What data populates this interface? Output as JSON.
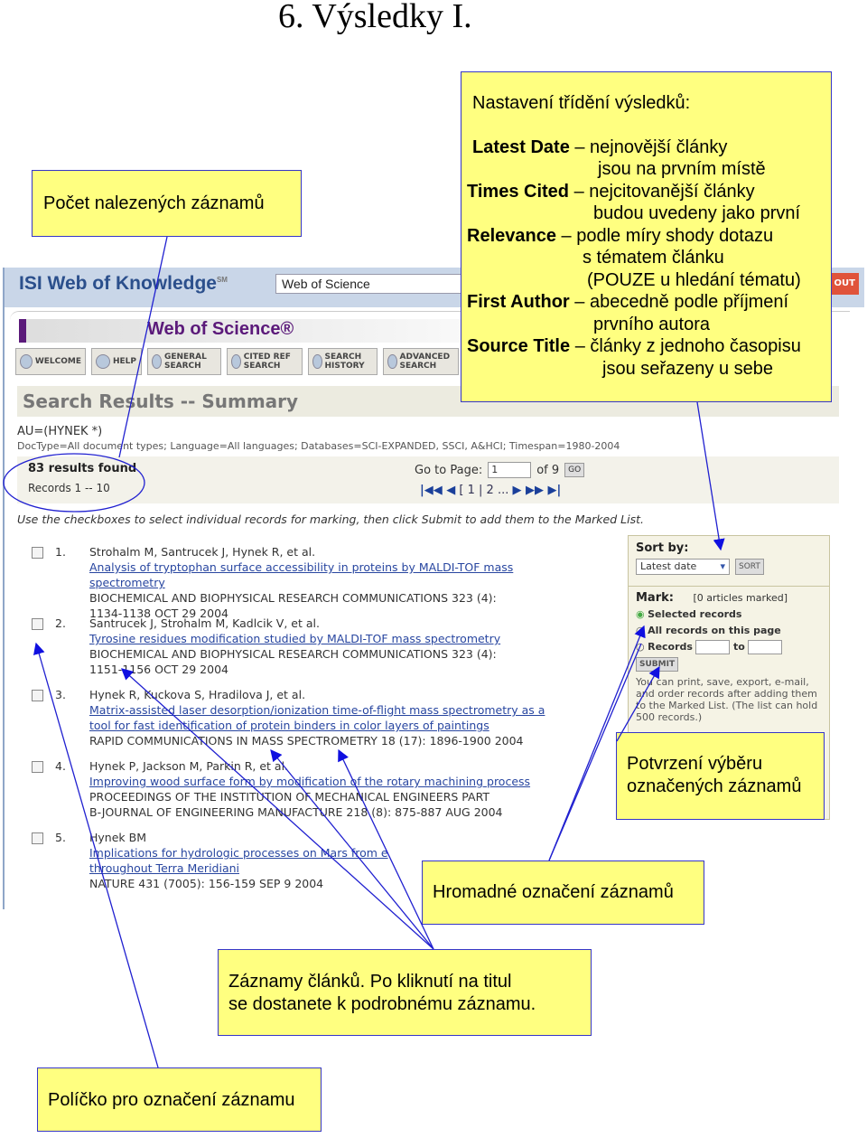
{
  "title": "6.  Výsledky I.",
  "screenshot": {
    "brand": "ISI Web of Knowledge",
    "brand_sup": "SM",
    "database_select": "Web of Science",
    "logout": "OUT",
    "wos_logo": "Web of Science®",
    "nav": [
      {
        "label": "WELCOME",
        "icon": "home-icon"
      },
      {
        "label": "HELP",
        "icon": "help-icon"
      },
      {
        "label": "GENERAL SEARCH",
        "icon": "search-icon"
      },
      {
        "label": "CITED REF SEARCH",
        "icon": "search-icon"
      },
      {
        "label": "SEARCH HISTORY",
        "icon": "history-icon"
      },
      {
        "label": "ADVANCED SEARCH",
        "icon": "advanced-search-icon"
      }
    ],
    "section_title": "Search Results -- Summary",
    "query": "AU=(HYNEK *)",
    "doctype": "DocType=All document types; Language=All languages; Databases=SCI-EXPANDED, SSCI, A&HCI; Timespan=1980-2004",
    "results_found": "83 results found",
    "records_range": "Records 1 -- 10",
    "goto_label": "Go to Page:",
    "goto_value": "1",
    "of_pages": "of 9",
    "go": "GO",
    "pager": "[ 1 | 2 ...",
    "instructions": "Use the checkboxes to select individual records for marking, then click Submit to add them to the Marked List.",
    "records": [
      {
        "num": "1.",
        "authors": "Strohalm M, Santrucek J, Hynek R, et al.",
        "title1": "Analysis of tryptophan surface accessibility in proteins by MALDI-TOF mass",
        "title2": "spectrometry",
        "source1": "BIOCHEMICAL AND BIOPHYSICAL RESEARCH COMMUNICATIONS 323 (4):",
        "source2": "1134-1138 OCT 29 2004"
      },
      {
        "num": "2.",
        "authors": "Santrucek J, Strohalm M, Kadlcik V, et al.",
        "title1": "Tyrosine residues modification studied by MALDI-TOF mass spectrometry",
        "title2": "",
        "source1": "BIOCHEMICAL AND BIOPHYSICAL RESEARCH COMMUNICATIONS 323 (4):",
        "source2": "1151-1156 OCT 29 2004"
      },
      {
        "num": "3.",
        "authors": "Hynek R, Kuckova S, Hradilova J, et al.",
        "title1": "Matrix-assisted laser desorption/ionization time-of-flight mass spectrometry as a",
        "title2": "tool for fast identification of protein binders in color layers of paintings",
        "source1": "RAPID COMMUNICATIONS IN MASS SPECTROMETRY 18 (17): 1896-1900 2004",
        "source2": ""
      },
      {
        "num": "4.",
        "authors": "Hynek P, Jackson M, Parkin R, et al.",
        "title1": "Improving wood surface form by modification of the rotary machining process",
        "title2": "",
        "source1": "PROCEEDINGS OF THE INSTITUTION OF MECHANICAL ENGINEERS PART",
        "source2": "B-JOURNAL OF ENGINEERING MANUFACTURE 218 (8): 875-887 AUG 2004"
      },
      {
        "num": "5.",
        "authors": "Hynek BM",
        "title1": "Implications for hydrologic processes on Mars from e",
        "title2": "throughout Terra Meridiani",
        "source1": "NATURE 431 (7005): 156-159 SEP 9 2004",
        "source2": ""
      }
    ],
    "sidebar": {
      "sort_by": "Sort by:",
      "sort_value": "Latest date",
      "sort_button": "SORT",
      "mark": "Mark:",
      "marked_count": "[0 articles marked]",
      "opt_selected": "Selected records",
      "opt_all": "All records on this page",
      "opt_range": "Records",
      "to": "to",
      "submit": "SUBMIT",
      "note": "You can print, save, export, e-mail, and order records after adding them to the Marked List. (The list can hold 500 records.)"
    }
  },
  "annotations": {
    "count": "Počet nalezených záznamů",
    "sort_heading": "Nastavení třídění výsledků:",
    "sort_items": [
      {
        "term": "Latest Date",
        "desc1": "– nejnovější články",
        "desc2": "jsou na prvním místě"
      },
      {
        "term": "Times Cited",
        "desc1": "– nejcitovanější články",
        "desc2": "budou uvedeny jako první"
      },
      {
        "term": "Relevance",
        "desc1": "– podle míry shody dotazu",
        "desc2": "s tématem článku",
        "desc3": "(POUZE u hledání tématu)"
      },
      {
        "term": "First Author",
        "desc1": "– abecedně podle příjmení",
        "desc2": "prvního autora"
      },
      {
        "term": "Source Title",
        "desc1": "– články z jednoho časopisu",
        "desc2": "jsou seřazeny u sebe"
      }
    ],
    "confirm": "Potvrzení výběru označených záznamů",
    "bulk": "Hromadné označení záznamů",
    "records1": "Záznamy článků. Po kliknutí na titul",
    "records2": "se dostanete k podrobnému záznamu.",
    "checkbox": "Políčko pro označení záznamu",
    "accent": "#3636c8",
    "fill": "#ffff80"
  }
}
